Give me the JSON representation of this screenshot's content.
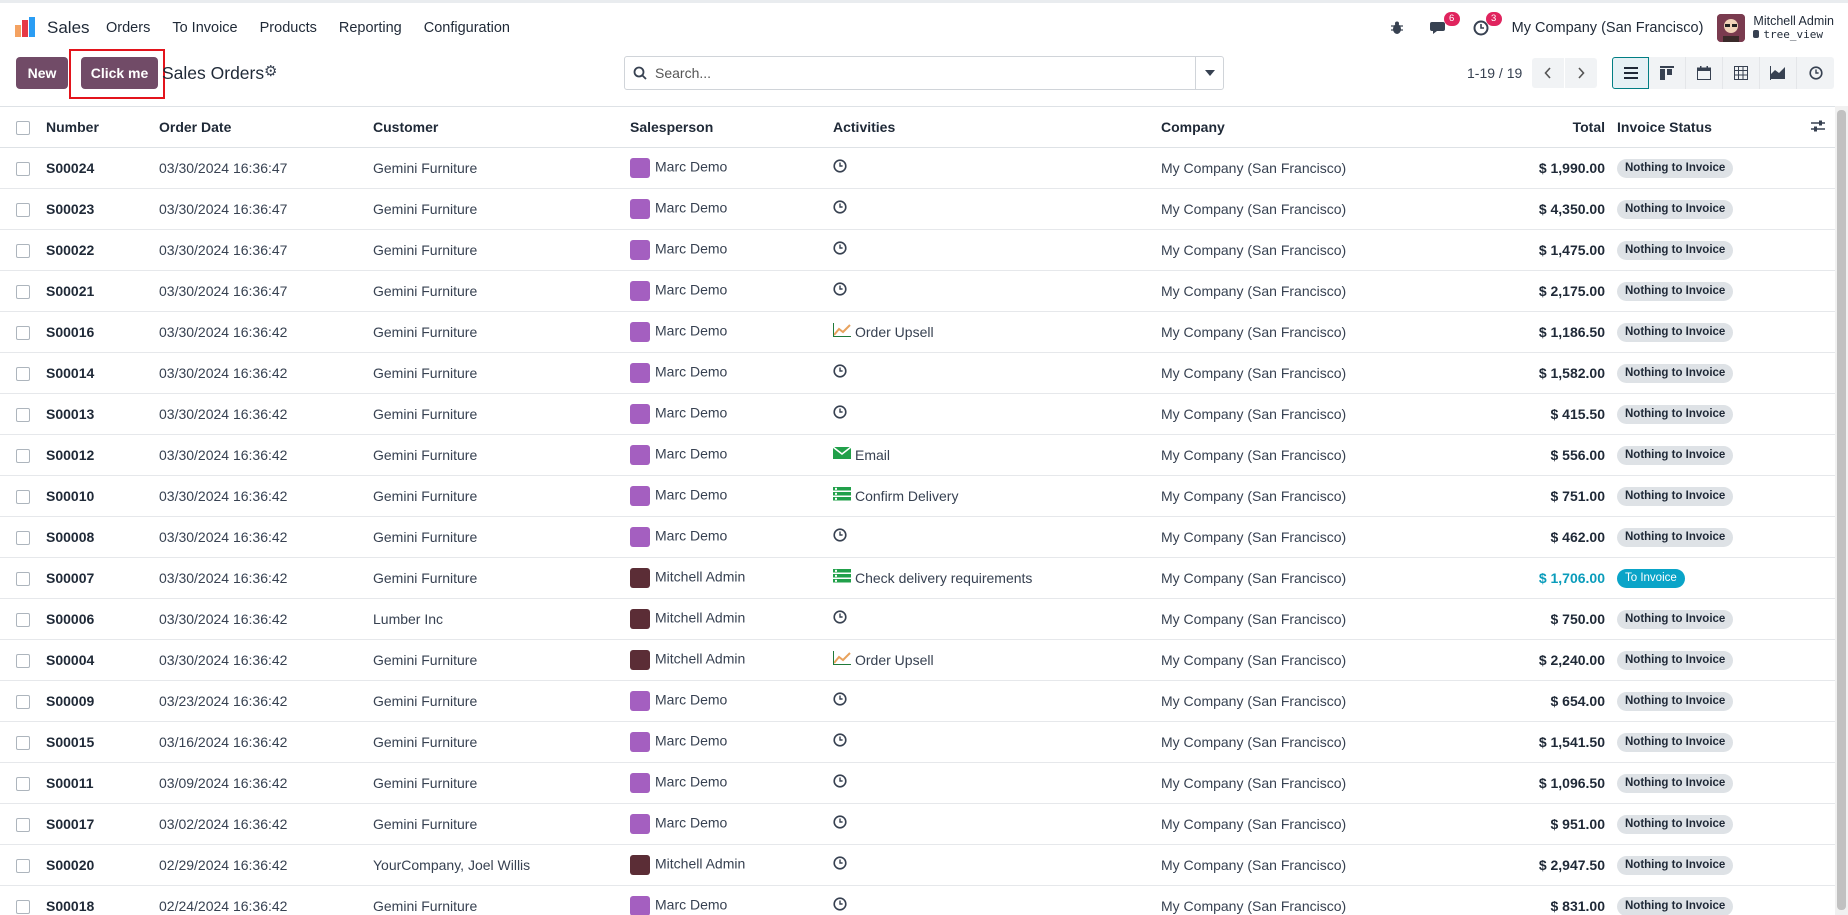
{
  "navbar": {
    "app_name": "Sales",
    "menu": [
      "Orders",
      "To Invoice",
      "Products",
      "Reporting",
      "Configuration"
    ],
    "messages_count": "6",
    "activities_count": "3",
    "company": "My Company (San Francisco)",
    "user_name": "Mitchell Admin",
    "user_db": "tree_view"
  },
  "control": {
    "new_label": "New",
    "click_label": "Click me",
    "breadcrumb": "Sales Orders",
    "search_placeholder": "Search...",
    "pager": "1-19 / 19"
  },
  "list": {
    "columns": {
      "number": "Number",
      "order_date": "Order Date",
      "customer": "Customer",
      "salesperson": "Salesperson",
      "activities": "Activities",
      "company": "Company",
      "total": "Total",
      "invoice_status": "Invoice Status"
    },
    "rows": [
      {
        "number": "S00024",
        "date": "03/30/2024 16:36:47",
        "customer": "Gemini Furniture",
        "salesperson": "Marc Demo",
        "activity": "",
        "activity_icon": "clock-icon",
        "company": "My Company (San Francisco)",
        "total": "$ 1,990.00",
        "status": "Nothing to Invoice"
      },
      {
        "number": "S00023",
        "date": "03/30/2024 16:36:47",
        "customer": "Gemini Furniture",
        "salesperson": "Marc Demo",
        "activity": "",
        "activity_icon": "clock-icon",
        "company": "My Company (San Francisco)",
        "total": "$ 4,350.00",
        "status": "Nothing to Invoice"
      },
      {
        "number": "S00022",
        "date": "03/30/2024 16:36:47",
        "customer": "Gemini Furniture",
        "salesperson": "Marc Demo",
        "activity": "",
        "activity_icon": "clock-icon",
        "company": "My Company (San Francisco)",
        "total": "$ 1,475.00",
        "status": "Nothing to Invoice"
      },
      {
        "number": "S00021",
        "date": "03/30/2024 16:36:47",
        "customer": "Gemini Furniture",
        "salesperson": "Marc Demo",
        "activity": "",
        "activity_icon": "clock-icon",
        "company": "My Company (San Francisco)",
        "total": "$ 2,175.00",
        "status": "Nothing to Invoice"
      },
      {
        "number": "S00016",
        "date": "03/30/2024 16:36:42",
        "customer": "Gemini Furniture",
        "salesperson": "Marc Demo",
        "activity": "Order Upsell",
        "activity_icon": "upsell-chart-icon",
        "company": "My Company (San Francisco)",
        "total": "$ 1,186.50",
        "status": "Nothing to Invoice"
      },
      {
        "number": "S00014",
        "date": "03/30/2024 16:36:42",
        "customer": "Gemini Furniture",
        "salesperson": "Marc Demo",
        "activity": "",
        "activity_icon": "clock-icon",
        "company": "My Company (San Francisco)",
        "total": "$ 1,582.00",
        "status": "Nothing to Invoice"
      },
      {
        "number": "S00013",
        "date": "03/30/2024 16:36:42",
        "customer": "Gemini Furniture",
        "salesperson": "Marc Demo",
        "activity": "",
        "activity_icon": "clock-icon",
        "company": "My Company (San Francisco)",
        "total": "$ 415.50",
        "status": "Nothing to Invoice"
      },
      {
        "number": "S00012",
        "date": "03/30/2024 16:36:42",
        "customer": "Gemini Furniture",
        "salesperson": "Marc Demo",
        "activity": "Email",
        "activity_icon": "email-icon",
        "company": "My Company (San Francisco)",
        "total": "$ 556.00",
        "status": "Nothing to Invoice"
      },
      {
        "number": "S00010",
        "date": "03/30/2024 16:36:42",
        "customer": "Gemini Furniture",
        "salesperson": "Marc Demo",
        "activity": "Confirm Delivery",
        "activity_icon": "todo-list-icon",
        "company": "My Company (San Francisco)",
        "total": "$ 751.00",
        "status": "Nothing to Invoice"
      },
      {
        "number": "S00008",
        "date": "03/30/2024 16:36:42",
        "customer": "Gemini Furniture",
        "salesperson": "Marc Demo",
        "activity": "",
        "activity_icon": "clock-icon",
        "company": "My Company (San Francisco)",
        "total": "$ 462.00",
        "status": "Nothing to Invoice"
      },
      {
        "number": "S00007",
        "date": "03/30/2024 16:36:42",
        "customer": "Gemini Furniture",
        "salesperson": "Mitchell Admin",
        "activity": "Check delivery requirements",
        "activity_icon": "todo-list-icon",
        "company": "My Company (San Francisco)",
        "total": "$ 1,706.00",
        "status": "To Invoice"
      },
      {
        "number": "S00006",
        "date": "03/30/2024 16:36:42",
        "customer": "Lumber Inc",
        "salesperson": "Mitchell Admin",
        "activity": "",
        "activity_icon": "clock-icon",
        "company": "My Company (San Francisco)",
        "total": "$ 750.00",
        "status": "Nothing to Invoice"
      },
      {
        "number": "S00004",
        "date": "03/30/2024 16:36:42",
        "customer": "Gemini Furniture",
        "salesperson": "Mitchell Admin",
        "activity": "Order Upsell",
        "activity_icon": "upsell-chart-icon",
        "company": "My Company (San Francisco)",
        "total": "$ 2,240.00",
        "status": "Nothing to Invoice"
      },
      {
        "number": "S00009",
        "date": "03/23/2024 16:36:42",
        "customer": "Gemini Furniture",
        "salesperson": "Marc Demo",
        "activity": "",
        "activity_icon": "clock-icon",
        "company": "My Company (San Francisco)",
        "total": "$ 654.00",
        "status": "Nothing to Invoice"
      },
      {
        "number": "S00015",
        "date": "03/16/2024 16:36:42",
        "customer": "Gemini Furniture",
        "salesperson": "Marc Demo",
        "activity": "",
        "activity_icon": "clock-icon",
        "company": "My Company (San Francisco)",
        "total": "$ 1,541.50",
        "status": "Nothing to Invoice"
      },
      {
        "number": "S00011",
        "date": "03/09/2024 16:36:42",
        "customer": "Gemini Furniture",
        "salesperson": "Marc Demo",
        "activity": "",
        "activity_icon": "clock-icon",
        "company": "My Company (San Francisco)",
        "total": "$ 1,096.50",
        "status": "Nothing to Invoice"
      },
      {
        "number": "S00017",
        "date": "03/02/2024 16:36:42",
        "customer": "Gemini Furniture",
        "salesperson": "Marc Demo",
        "activity": "",
        "activity_icon": "clock-icon",
        "company": "My Company (San Francisco)",
        "total": "$ 951.00",
        "status": "Nothing to Invoice"
      },
      {
        "number": "S00020",
        "date": "02/29/2024 16:36:42",
        "customer": "YourCompany, Joel Willis",
        "salesperson": "Mitchell Admin",
        "activity": "",
        "activity_icon": "clock-icon",
        "company": "My Company (San Francisco)",
        "total": "$ 2,947.50",
        "status": "Nothing to Invoice"
      },
      {
        "number": "S00018",
        "date": "02/24/2024 16:36:42",
        "customer": "Gemini Furniture",
        "salesperson": "Marc Demo",
        "activity": "",
        "activity_icon": "clock-icon",
        "company": "My Company (San Francisco)",
        "total": "$ 831.00",
        "status": "Nothing to Invoice"
      }
    ]
  },
  "colors": {
    "brand": "#714b67",
    "highlight_frame": "#e3141c",
    "to_invoice": "#0aa4c8",
    "notification": "#e0245e"
  }
}
